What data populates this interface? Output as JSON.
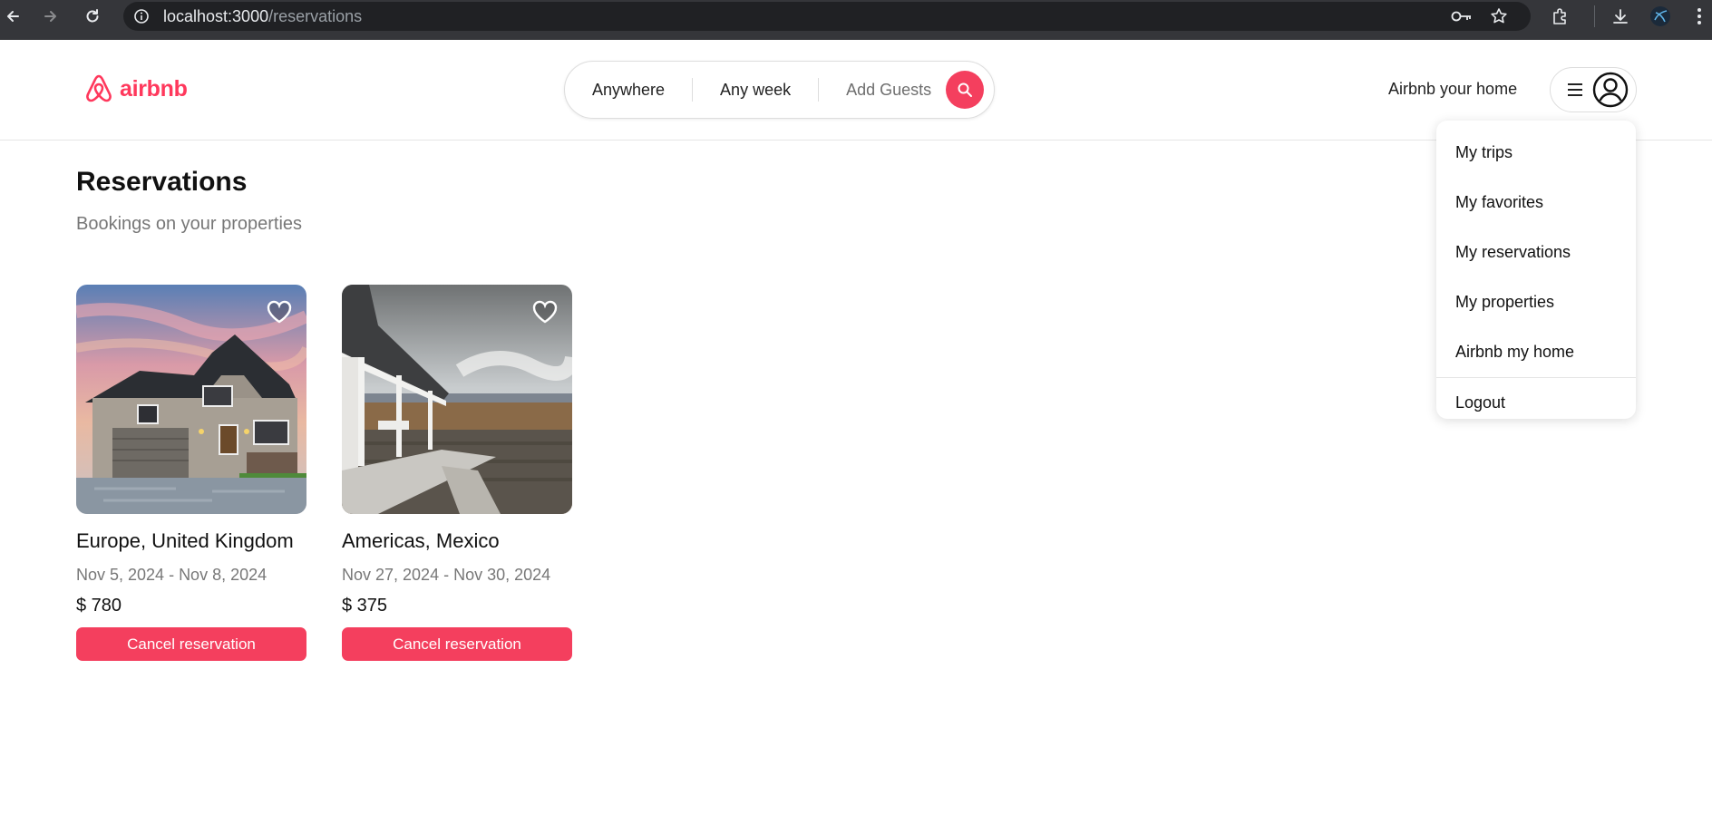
{
  "browser": {
    "url_host": "localhost:3000",
    "url_path": "/reservations"
  },
  "navbar": {
    "logo_text": "airbnb",
    "search": {
      "anywhere": "Anywhere",
      "any_week": "Any week",
      "add_guests": "Add Guests"
    },
    "host_link": "Airbnb your home"
  },
  "user_menu": {
    "items": [
      "My trips",
      "My favorites",
      "My reservations",
      "My properties",
      "Airbnb my home"
    ],
    "logout": "Logout"
  },
  "page": {
    "title": "Reservations",
    "subtitle": "Bookings on your properties"
  },
  "reservations": [
    {
      "location": "Europe, United Kingdom",
      "dates": "Nov 5, 2024 - Nov 8, 2024",
      "price": "$ 780",
      "action": "Cancel reservation"
    },
    {
      "location": "Americas, Mexico",
      "dates": "Nov 27, 2024 - Nov 30, 2024",
      "price": "$ 375",
      "action": "Cancel reservation"
    }
  ],
  "colors": {
    "brand": "#ff385c",
    "button": "#f43f5e"
  }
}
